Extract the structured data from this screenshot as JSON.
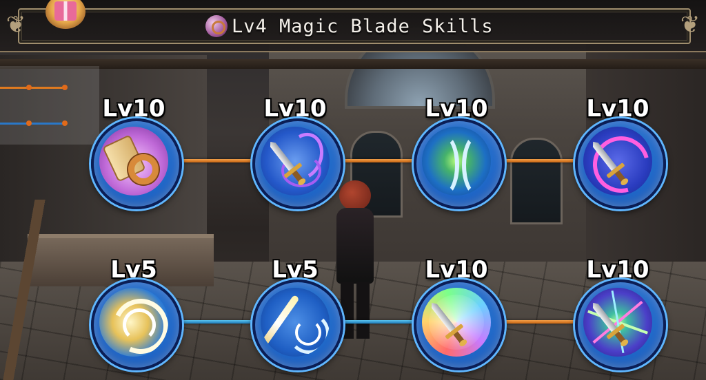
{
  "header": {
    "title": "Lv4 Magic Blade Skills"
  },
  "skills": [
    {
      "level": "Lv10",
      "icon": "scroll-ring-icon",
      "row": 1,
      "col": 1
    },
    {
      "level": "Lv10",
      "icon": "sword-purple-magic-icon",
      "row": 1,
      "col": 2
    },
    {
      "level": "Lv10",
      "icon": "green-barrier-icon",
      "row": 1,
      "col": 3
    },
    {
      "level": "Lv10",
      "icon": "sword-pink-aura-icon",
      "row": 1,
      "col": 4
    },
    {
      "level": "Lv5",
      "icon": "wind-swirl-icon",
      "row": 2,
      "col": 1
    },
    {
      "level": "Lv5",
      "icon": "slash-arcs-icon",
      "row": 2,
      "col": 2
    },
    {
      "level": "Lv10",
      "icon": "sword-rainbow-icon",
      "row": 2,
      "col": 3
    },
    {
      "level": "Lv10",
      "icon": "sword-starburst-icon",
      "row": 2,
      "col": 4
    }
  ],
  "connectors": {
    "row1": [
      "orange",
      "orange",
      "orange"
    ],
    "row2": [
      "blue",
      "blue",
      "orange"
    ]
  },
  "colors": {
    "orange_link": "#e07a1f",
    "blue_link": "#2a9bd6",
    "orb_blue": "#1c62c4",
    "frame_gold": "#a08e6e"
  }
}
